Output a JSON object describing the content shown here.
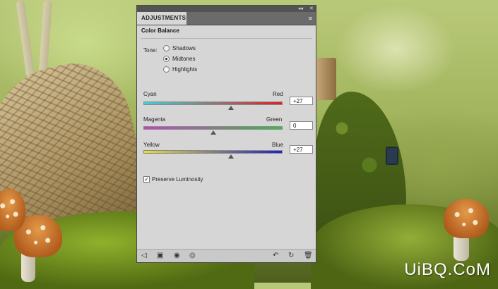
{
  "panel": {
    "tab_title": "ADJUSTMENTS",
    "heading": "Color Balance",
    "window_controls": [
      "◂◂",
      "✕"
    ],
    "menu_icon": "≡"
  },
  "tone": {
    "label": "Tone:",
    "options": [
      "Shadows",
      "Midtones",
      "Highlights"
    ],
    "selected": "Midtones"
  },
  "sliders": [
    {
      "left": "Cyan",
      "right": "Red",
      "value": "+27",
      "colors": [
        "#3fd0d6",
        "#e02020"
      ]
    },
    {
      "left": "Magenta",
      "right": "Green",
      "value": "0",
      "colors": [
        "#d23ad2",
        "#2cc43a"
      ]
    },
    {
      "left": "Yellow",
      "right": "Blue",
      "value": "+27",
      "colors": [
        "#e8e030",
        "#2020d0"
      ]
    }
  ],
  "preserve": {
    "label": "Preserve Luminosity",
    "checked": true
  },
  "bottom_icons": [
    "back-arrow-icon",
    "clip-layer-icon",
    "visibility-eye-icon",
    "eye-icon",
    "previous-state-icon",
    "reset-icon",
    "trash-icon"
  ],
  "watermark": "UiBQ.CoM"
}
